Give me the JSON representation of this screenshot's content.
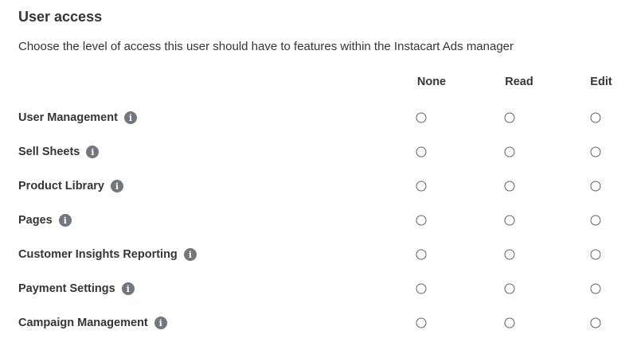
{
  "section": {
    "title": "User access",
    "description": "Choose the level of access this user should have to features within the Instacart Ads manager"
  },
  "columns": [
    "None",
    "Read",
    "Edit"
  ],
  "icons": {
    "info": "info-icon"
  },
  "colors": {
    "text": "#343538",
    "icon": "#72767e",
    "radio_border": "#5f6368"
  },
  "permissions": [
    {
      "label": "User Management",
      "selected": null
    },
    {
      "label": "Sell Sheets",
      "selected": null
    },
    {
      "label": "Product Library",
      "selected": null
    },
    {
      "label": "Pages",
      "selected": null
    },
    {
      "label": "Customer Insights Reporting",
      "selected": null
    },
    {
      "label": "Payment Settings",
      "selected": null
    },
    {
      "label": "Campaign Management",
      "selected": null
    }
  ]
}
